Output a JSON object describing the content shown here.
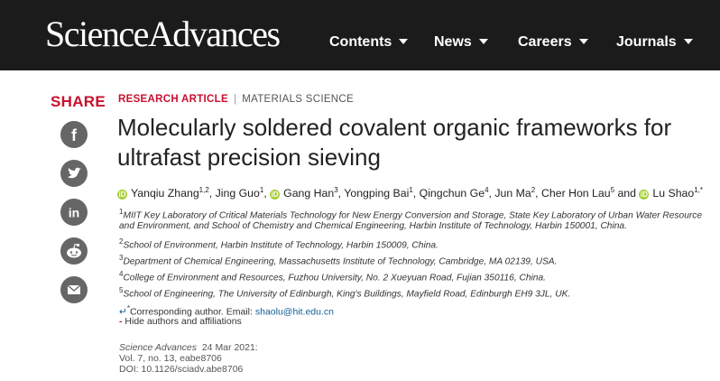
{
  "header": {
    "logo": "ScienceAdvances",
    "nav": [
      {
        "label": "Contents"
      },
      {
        "label": "News"
      },
      {
        "label": "Careers"
      },
      {
        "label": "Journals"
      }
    ]
  },
  "share": {
    "label": "SHARE",
    "icons": [
      "facebook-icon",
      "twitter-icon",
      "linkedin-icon",
      "reddit-icon",
      "email-icon"
    ]
  },
  "article": {
    "type": "RESEARCH ARTICLE",
    "subject": "MATERIALS SCIENCE",
    "title_line1": "Molecularly soldered covalent organic frameworks for",
    "title_line2": "ultrafast precision sieving",
    "authors": [
      {
        "name": "Yanqiu Zhang",
        "sup": "1,2",
        "orcid": true
      },
      {
        "name": "Jing Guo",
        "sup": "1",
        "orcid": false
      },
      {
        "name": "Gang Han",
        "sup": "3",
        "orcid": true
      },
      {
        "name": "Yongping Bai",
        "sup": "1",
        "orcid": false
      },
      {
        "name": "Qingchun Ge",
        "sup": "4",
        "orcid": false
      },
      {
        "name": "Jun Ma",
        "sup": "2",
        "orcid": false
      },
      {
        "name": "Cher Hon Lau",
        "sup": "5",
        "orcid": false
      },
      {
        "name": "Lu Shao",
        "sup": "1,*",
        "orcid": true
      }
    ],
    "and_word": "and",
    "affiliations": [
      {
        "num": "1",
        "text": "MIIT Key Laboratory of Critical Materials Technology for New Energy Conversion and Storage, State Key Laboratory of Urban Water Resource and Environment, and School of Chemistry and Chemical Engineering, Harbin Institute of Technology, Harbin 150001, China."
      },
      {
        "num": "2",
        "text": "School of Environment, Harbin Institute of Technology, Harbin 150009, China."
      },
      {
        "num": "3",
        "text": "Department of Chemical Engineering, Massachusetts Institute of Technology, Cambridge, MA 02139, USA."
      },
      {
        "num": "4",
        "text": "College of Environment and Resources, Fuzhou University, No. 2 Xueyuan Road, Fujian 350116, China."
      },
      {
        "num": "5",
        "text": "School of Engineering, The University of Edinburgh, King's Buildings, Mayfield Road, Edinburgh EH9 3JL, UK."
      }
    ],
    "corresponding_label": "Corresponding author. Email:",
    "corresponding_email": "shaolu@hit.edu.cn",
    "hide_label": "Hide authors and affiliations",
    "journal": "Science Advances",
    "date": "24 Mar 2021:",
    "volume": "Vol. 7, no. 13, eabe8706",
    "doi": "DOI: 10.1126/sciadv.abe8706"
  },
  "colors": {
    "accent": "#c8102e",
    "header_bg": "#1b1b1b",
    "orcid": "#a6ce39",
    "link": "#135e96"
  }
}
